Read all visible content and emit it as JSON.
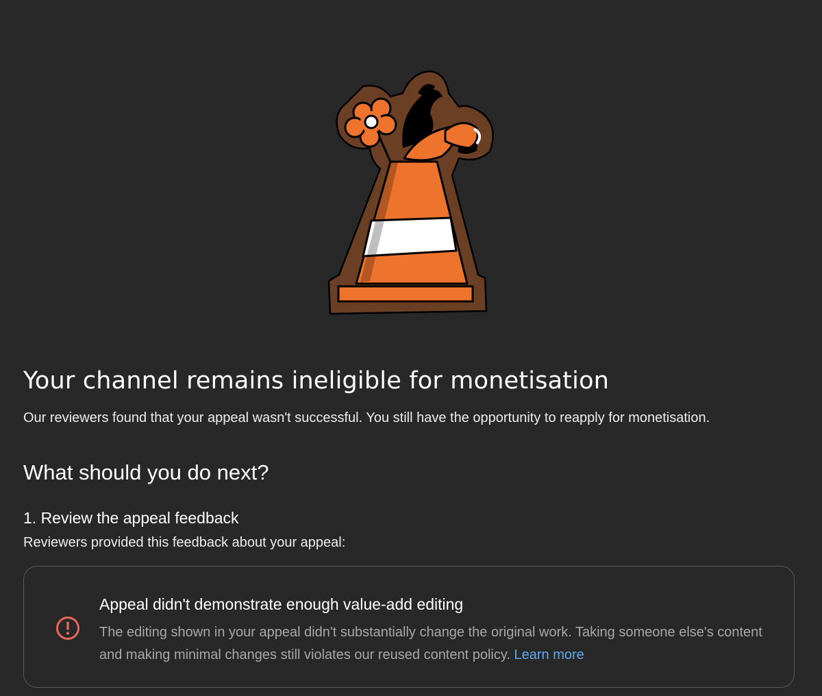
{
  "illustration": {
    "icon": "traffic-cone-with-flowers-illustration"
  },
  "header": {
    "title": "Your channel remains ineligible for monetisation",
    "subtitle": "Our reviewers found that your appeal wasn't successful. You still have the opportunity to reapply for monetisation."
  },
  "next_steps": {
    "heading": "What should you do next?",
    "step1": {
      "title": "1. Review the appeal feedback",
      "description": "Reviewers provided this feedback about your appeal:"
    }
  },
  "feedback": {
    "icon": "alert-circle-icon",
    "title": "Appeal didn't demonstrate enough value-add editing",
    "body": "The editing shown in your appeal didn't substantially change the original work. Taking someone else's content and making minimal changes still violates our reused content policy.",
    "link_label": "Learn more"
  },
  "colors": {
    "background": "#282828",
    "alert": "#e8685c",
    "link": "#5eaaf2",
    "cone": "#ee742e",
    "cone_outline": "#6b3f24"
  }
}
